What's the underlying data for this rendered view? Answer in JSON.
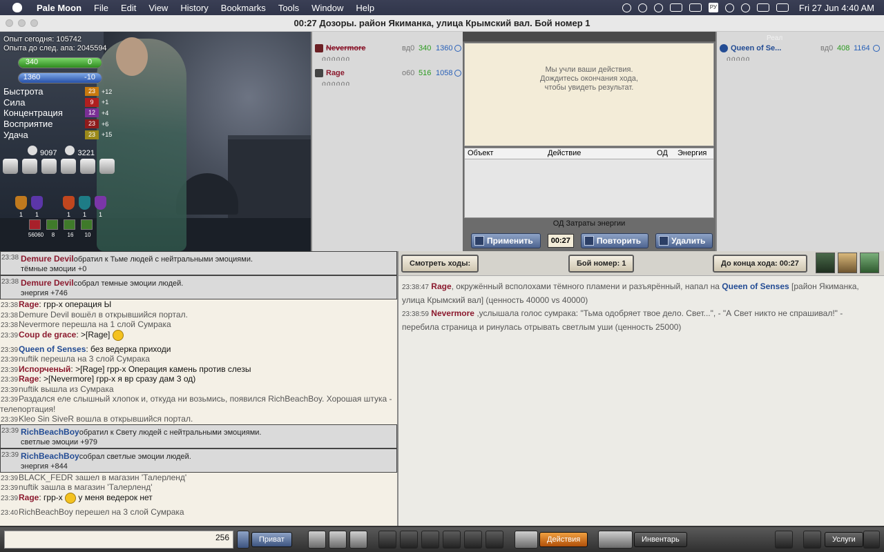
{
  "menubar": {
    "app_name": "Pale Moon",
    "menus": [
      "File",
      "Edit",
      "View",
      "History",
      "Bookmarks",
      "Tools",
      "Window",
      "Help"
    ],
    "language": "РУ",
    "clock": "Fri 27 Jun  4:40 AM",
    "tray_icons": [
      "creative-cloud-icon",
      "focus-icon",
      "play-icon",
      "volume-icon",
      "battery-icon",
      "keyboard-layout-icon",
      "bluetooth-icon",
      "wifi-icon",
      "notification-icon",
      "control-center-icon"
    ]
  },
  "window": {
    "title": "00:27 Дозоры. район Якиманка, улица Крымский вал. Бой номер 1"
  },
  "character": {
    "exp_today": "Опыт сегодня: 105742",
    "exp_next": "Опыта до след. апа: 2045594",
    "hp": "340",
    "hp_right": "0",
    "energy": "1360",
    "energy_right": "-10",
    "stats": [
      {
        "name": "Быстрота",
        "value": "23",
        "bonus": "+12",
        "color": "#c8790e"
      },
      {
        "name": "Сила",
        "value": "9",
        "bonus": "+1",
        "color": "#b01f1f"
      },
      {
        "name": "Концентрация",
        "value": "12",
        "bonus": "+4",
        "color": "#7a2f95"
      },
      {
        "name": "Восприятие",
        "value": "23",
        "bonus": "+6",
        "color": "#8f1b1b"
      },
      {
        "name": "Удача",
        "value": "23",
        "bonus": "+15",
        "color": "#9c8a1a"
      }
    ],
    "stars": "9097",
    "skulls": "3221",
    "badges": [
      "1",
      "1",
      "1",
      "1",
      "1"
    ],
    "items": [
      "56060",
      "8",
      "16",
      "10"
    ]
  },
  "left_team": {
    "fighters": [
      {
        "name": "Nevermore",
        "level": "вд0",
        "hp": "340",
        "energy": "1360",
        "slots": "ሰሰሰሰሰሰ"
      },
      {
        "name": "Rage",
        "level": "о60",
        "hp": "516",
        "energy": "1058",
        "slots": "ሰሰሰሰሰሰ"
      }
    ]
  },
  "right_team": {
    "label": "Реал",
    "fighters": [
      {
        "name": "Queen of Se...",
        "level": "вд0",
        "hp": "408",
        "energy": "1164",
        "slots": "ሰሰሰሰሰ"
      }
    ]
  },
  "center": {
    "message_line1": "Мы учли ваши действия.",
    "message_line2": "Дождитесь окончания хода,",
    "message_line3": "чтобы увидеть результат.",
    "col_object": "Объект",
    "col_action": "Действие",
    "col_od": "ОД",
    "col_energy": "Энергия",
    "costs_od": "ОД",
    "costs_energy": "Затраты энергии",
    "apply": "Применить",
    "timer": "00:27",
    "repeat": "Повторить",
    "delete": "Удалить"
  },
  "chat": [
    {
      "time": "23:38",
      "name": "Demure Devil",
      "name_class": "",
      "text": "обратил к Тьме людей с нейтральными эмоциями.",
      "sub": "тёмные эмоции +0",
      "boxed": true
    },
    {
      "time": "23:38",
      "name": "Demure Devil",
      "name_class": "",
      "text": "собрал темные эмоции людей.",
      "sub": "энергия +746",
      "boxed": true
    },
    {
      "time": "23:38",
      "name": "Rage",
      "name_class": "",
      "text": ":  грр-х операция Ы",
      "sub": "",
      "boxed": false
    },
    {
      "time": "23:38",
      "name": "",
      "name_class": "",
      "text": "Demure Devil вошёл в открывшийся портал.",
      "sub": "",
      "boxed": false
    },
    {
      "time": "23:38",
      "name": "",
      "name_class": "",
      "text": "Nevermore перешла на 1 слой Сумрака",
      "sub": "",
      "boxed": false
    },
    {
      "time": "23:39",
      "name": "Coup de grace",
      "name_class": "",
      "text": ":  >[Rage]",
      "sub": "",
      "boxed": false,
      "smiley": true
    },
    {
      "time": "23:39",
      "name": "Queen of Senses",
      "name_class": "blue",
      "text": ":  без ведерка приходи",
      "sub": "",
      "boxed": false
    },
    {
      "time": "23:39",
      "name": "",
      "name_class": "",
      "text": "nuftik перешла на 3 слой Сумрака",
      "sub": "",
      "boxed": false
    },
    {
      "time": "23:39",
      "name": "Испорченый",
      "name_class": "",
      "text": ":  >[Rage]  грр-х Операция камень против слезы",
      "sub": "",
      "boxed": false
    },
    {
      "time": "23:39",
      "name": "Rage",
      "name_class": "",
      "text": ":  >[Nevermore]  грр-х я вр сразу дам 3 од)",
      "sub": "",
      "boxed": false
    },
    {
      "time": "23:39",
      "name": "",
      "name_class": "",
      "text": "nuftik вышла из Сумрака",
      "sub": "",
      "boxed": false
    },
    {
      "time": "23:39",
      "name": "",
      "name_class": "",
      "text": "Раздался еле слышный хлопок и, откуда ни возьмись, появился RichBeachBoy. Хорошая штука -",
      "sub": "телепортация!",
      "boxed": false
    },
    {
      "time": "23:39",
      "name": "",
      "name_class": "",
      "text": "Kleo Sin SiveR вошла в открывшийся портал.",
      "sub": "",
      "boxed": false
    },
    {
      "time": "23:39",
      "name": "RichBeachBoy",
      "name_class": "blue",
      "text": "обратил к Свету людей с нейтральными эмоциями.",
      "sub": "светлые эмоции +979",
      "boxed": true
    },
    {
      "time": "23:39",
      "name": "RichBeachBoy",
      "name_class": "blue",
      "text": "собрал светлые эмоции людей.",
      "sub": "энергия +844",
      "boxed": true
    },
    {
      "time": "23:39",
      "name": "",
      "name_class": "",
      "text": "BLACK_FEDR зашел в магазин 'Талерленд'",
      "sub": "",
      "boxed": false
    },
    {
      "time": "23:39",
      "name": "",
      "name_class": "",
      "text": "nuftik зашла в магазин 'Талерленд'",
      "sub": "",
      "boxed": false
    },
    {
      "time": "23:39",
      "name": "Rage",
      "name_class": "",
      "text": ":  грр-х",
      "sub": "",
      "boxed": false,
      "smiley_after": "у меня ведерок нет"
    },
    {
      "time": "23:40",
      "name": "",
      "name_class": "",
      "text": "RichBeachBoy перешел на 3 слой Сумрака",
      "sub": "",
      "boxed": false
    }
  ],
  "log": {
    "btn_moves": "Смотреть ходы:",
    "btn_fight": "Бой номер: 1",
    "btn_turn": "До конца хода: 00:27",
    "entries": [
      {
        "time": "23:38:47",
        "name1": "Rage",
        "text1": ", окружённый всполохами тёмного пламени и разъярённый, напал на ",
        "name2": "Queen of Senses",
        "text2": " [район Якиманка, улица Крымский вал] (ценность 40000 vs 40000)"
      },
      {
        "time": "23:38:59",
        "name1": "Nevermore",
        "text1": " ,услышала голос сумрака: \"Тьма одобряет твое дело. Свет...\", - \"А Свет никто не спрашивал!\" - перебила страница и ринулась отрывать светлым уши (ценность 25000)",
        "name2": "",
        "text2": ""
      }
    ]
  },
  "bottom": {
    "char_count": "256",
    "private": "Приват",
    "actions": "Действия",
    "inventory": "Инвентарь",
    "services": "Услуги"
  }
}
